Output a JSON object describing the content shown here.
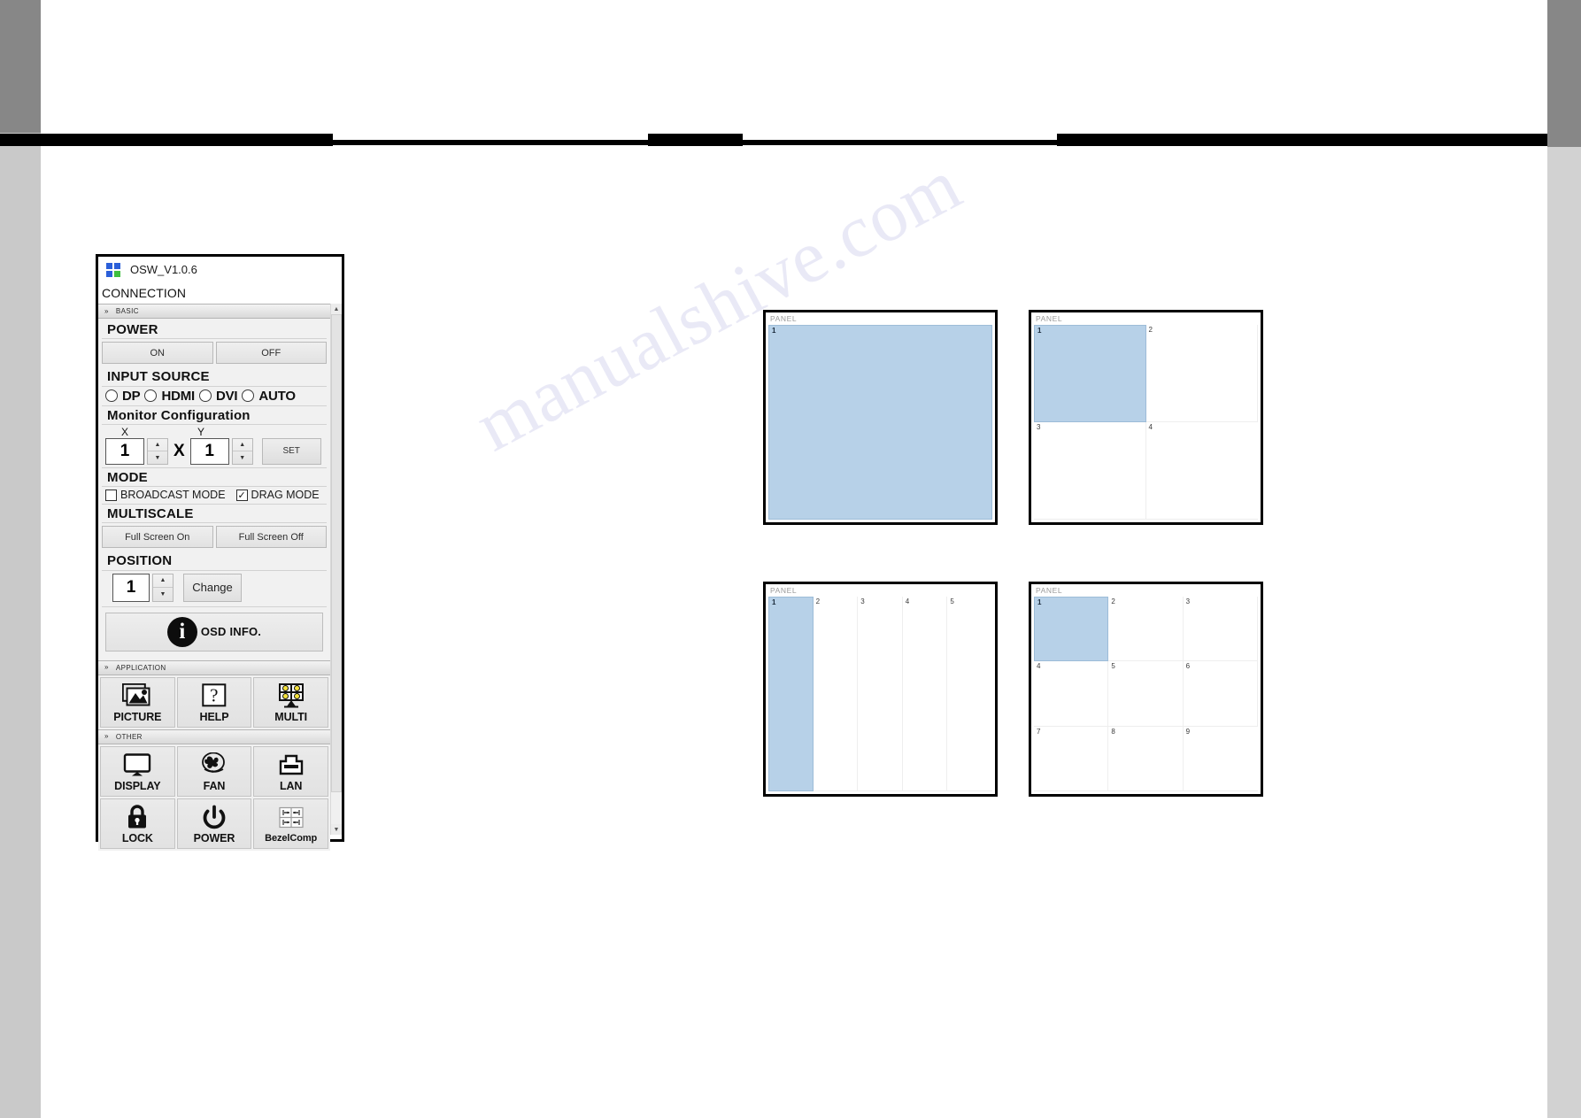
{
  "watermark": {
    "text": "manualshive.com"
  },
  "app": {
    "title": "OSW_V1.0.6",
    "logo_icon": "four-square-logo-icon",
    "connection_label": "CONNECTION",
    "groups": {
      "basic": "BASIC",
      "application": "APPLICATION",
      "other": "OTHER"
    },
    "power": {
      "section_title": "POWER",
      "on_label": "ON",
      "off_label": "OFF"
    },
    "input_source": {
      "section_title": "INPUT SOURCE",
      "options": [
        {
          "label": "DP",
          "selected": false
        },
        {
          "label": "HDMI",
          "selected": false
        },
        {
          "label": "DVI",
          "selected": false
        },
        {
          "label": "AUTO",
          "selected": false
        }
      ]
    },
    "monitor_configuration": {
      "section_title": "Monitor Configuration",
      "x_label": "X",
      "y_label": "Y",
      "x_value": "1",
      "y_value": "1",
      "multiply_symbol": "X",
      "set_label": "SET"
    },
    "mode": {
      "section_title": "MODE",
      "broadcast_label": "BROADCAST MODE",
      "broadcast_checked": false,
      "drag_label": "DRAG MODE",
      "drag_checked": true,
      "check_glyph": "✓"
    },
    "multiscale": {
      "section_title": "MULTISCALE",
      "full_screen_on_label": "Full Screen On",
      "full_screen_off_label": "Full Screen Off"
    },
    "position": {
      "section_title": "POSITION",
      "value": "1",
      "change_label": "Change"
    },
    "osd_info": {
      "label": "OSD INFO.",
      "icon": "info-circle-icon",
      "glyph": "i"
    },
    "application_buttons": [
      {
        "label": "PICTURE",
        "icon": "picture-icon"
      },
      {
        "label": "HELP",
        "icon": "question-mark-icon"
      },
      {
        "label": "MULTI",
        "icon": "multi-screen-icon"
      }
    ],
    "other_buttons": [
      {
        "label": "DISPLAY",
        "icon": "monitor-icon"
      },
      {
        "label": "FAN",
        "icon": "fan-icon"
      },
      {
        "label": "LAN",
        "icon": "ethernet-port-icon"
      },
      {
        "label": "LOCK",
        "icon": "padlock-icon"
      },
      {
        "label": "POWER",
        "icon": "power-symbol-icon"
      },
      {
        "label": "BezelComp",
        "icon": "bezel-compensation-icon"
      }
    ],
    "spinner": {
      "up_glyph": "▲",
      "down_glyph": "▼"
    },
    "scrollbar": {
      "up_glyph": "▲",
      "down_glyph": "▼"
    }
  },
  "panels": [
    {
      "name": "panel-1x1",
      "label": "PANEL",
      "cols": 1,
      "rows": 1,
      "cells": [
        {
          "num": "1",
          "selected": true
        }
      ]
    },
    {
      "name": "panel-2x2",
      "label": "PANEL",
      "cols": 2,
      "rows": 2,
      "cells": [
        {
          "num": "1",
          "selected": true
        },
        {
          "num": "2",
          "selected": false
        },
        {
          "num": "3",
          "selected": false
        },
        {
          "num": "4",
          "selected": false
        }
      ]
    },
    {
      "name": "panel-5x1",
      "label": "PANEL",
      "cols": 5,
      "rows": 1,
      "cells": [
        {
          "num": "1",
          "selected": true
        },
        {
          "num": "2",
          "selected": false
        },
        {
          "num": "3",
          "selected": false
        },
        {
          "num": "4",
          "selected": false
        },
        {
          "num": "5",
          "selected": false
        }
      ]
    },
    {
      "name": "panel-3x3",
      "label": "PANEL",
      "cols": 3,
      "rows": 3,
      "cells": [
        {
          "num": "1",
          "selected": true
        },
        {
          "num": "2",
          "selected": false
        },
        {
          "num": "3",
          "selected": false
        },
        {
          "num": "4",
          "selected": false
        },
        {
          "num": "5",
          "selected": false
        },
        {
          "num": "6",
          "selected": false
        },
        {
          "num": "7",
          "selected": false
        },
        {
          "num": "8",
          "selected": false
        },
        {
          "num": "9",
          "selected": false
        }
      ]
    }
  ],
  "colors": {
    "selected_cell": "#b7d1e8",
    "logo_blue": "#2b5fd9",
    "logo_green": "#3fbf3f",
    "watermark": "#b9b9e2"
  }
}
